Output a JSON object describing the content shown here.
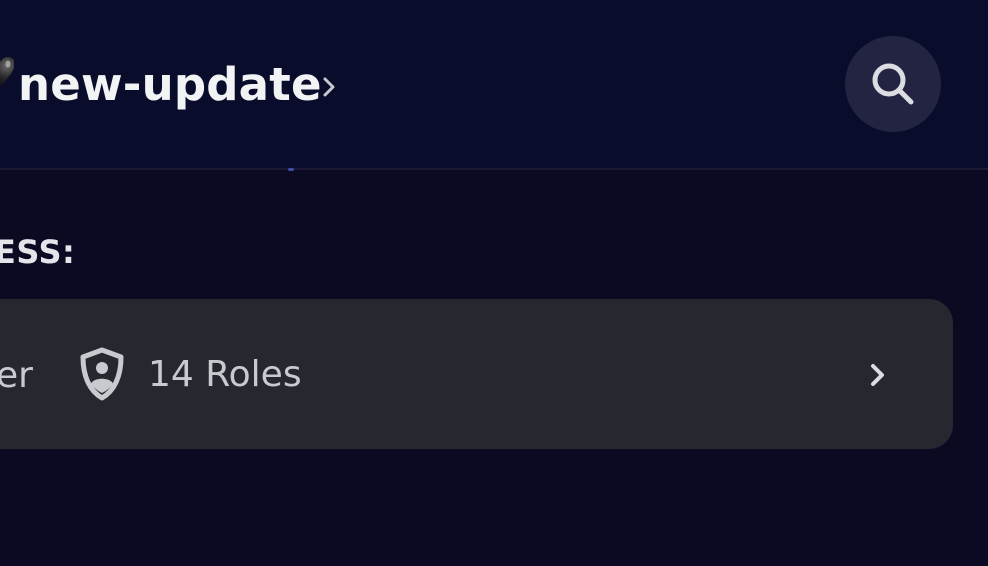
{
  "header": {
    "channel_name": "new-update",
    "emoji_icon": "black-heart-icon",
    "chevron_icon": "chevron-right-icon",
    "search_icon": "search-icon"
  },
  "section": {
    "label": "ESS:"
  },
  "access_card": {
    "partial_label": "er",
    "roles_label": "14 Roles",
    "roles_icon": "shield-person-icon",
    "chevron_icon": "chevron-right-icon"
  },
  "colors": {
    "header_bg": "#0a0c2b",
    "page_bg": "#0c0a22",
    "card_bg": "#27272f",
    "search_button_bg": "#232342",
    "text_primary": "#f2f3f5",
    "text_secondary": "#c9cad0"
  }
}
